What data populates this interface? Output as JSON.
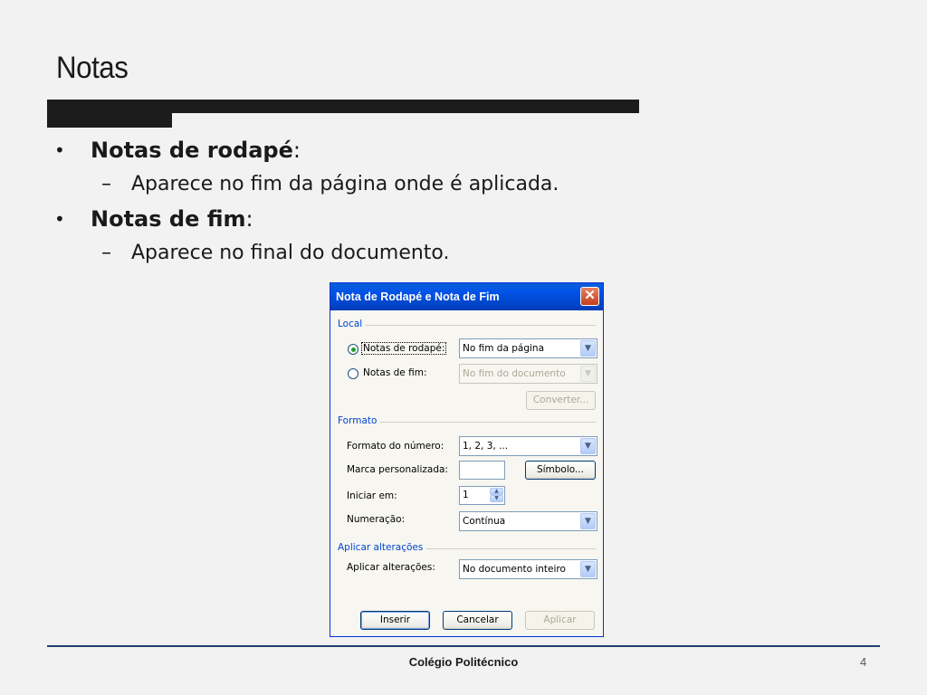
{
  "slide": {
    "title": "Notas",
    "bullets": [
      {
        "label": "Notas de rodapé",
        "suffix": ":",
        "sub": "Aparece no fim da página onde é aplicada."
      },
      {
        "label": "Notas de fim",
        "suffix": ":",
        "sub": "Aparece no final do documento."
      }
    ],
    "bullet_glyph": "•",
    "dash_glyph": "–",
    "footer": "Colégio Politécnico",
    "page_number": "4"
  },
  "dialog": {
    "title": "Nota de Rodapé e Nota de Fim",
    "close_glyph": "✕",
    "arrow_glyph": "▼",
    "local": {
      "group_label": "Local",
      "footnotes_label": "Notas de rodapé:",
      "footnotes_value": "No fim da página",
      "endnotes_label": "Notas de fim:",
      "endnotes_value": "No fim do documento",
      "convert_button": "Converter..."
    },
    "formato": {
      "group_label": "Formato",
      "number_format_label": "Formato do número:",
      "number_format_value": "1, 2, 3, ...",
      "custom_mark_label": "Marca personalizada:",
      "custom_mark_value": "",
      "symbol_button": "Símbolo...",
      "start_at_label": "Iniciar em:",
      "start_at_value": "1",
      "numbering_label": "Numeração:",
      "numbering_value": "Contínua"
    },
    "apply": {
      "group_label": "Aplicar alterações",
      "apply_to_label": "Aplicar alterações:",
      "apply_to_value": "No documento inteiro"
    },
    "buttons": {
      "insert": "Inserir",
      "cancel": "Cancelar",
      "apply": "Aplicar"
    }
  }
}
